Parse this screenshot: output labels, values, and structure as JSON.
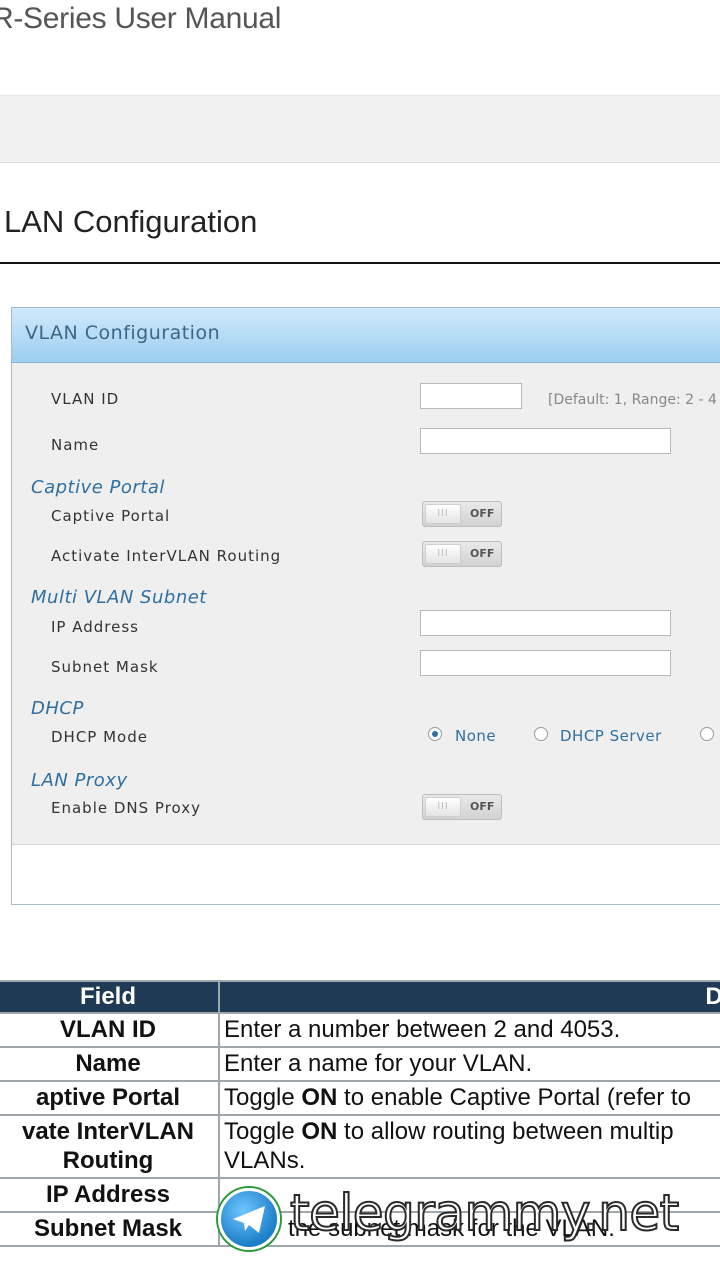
{
  "manual_title": "R-Series User Manual",
  "section_heading": "LAN Configuration",
  "panel": {
    "title": "VLAN Configuration",
    "vlan_id_label": "VLAN ID",
    "vlan_id_hint": "[Default: 1, Range: 2 - 4",
    "name_label": "Name",
    "captive_group": "Captive Portal",
    "captive_label": "Captive Portal",
    "captive_state": "OFF",
    "intervlan_label": "Activate InterVLAN Routing",
    "intervlan_state": "OFF",
    "multi_group": "Multi VLAN Subnet",
    "ip_label": "IP Address",
    "mask_label": "Subnet Mask",
    "dhcp_group": "DHCP",
    "dhcp_mode_label": "DHCP Mode",
    "dhcp_options": [
      "None",
      "DHCP Server"
    ],
    "dhcp_selected": "None",
    "proxy_group": "LAN Proxy",
    "dns_proxy_label": "Enable DNS Proxy",
    "dns_proxy_state": "OFF",
    "toggle_knob_glyph": "III"
  },
  "table": {
    "header_field": "Field",
    "header_desc": "De",
    "rows": [
      {
        "field": "VLAN ID",
        "desc_pre": "Enter a number between 2 and 4053.",
        "desc_bold": "",
        "desc_post": ""
      },
      {
        "field": "Name",
        "desc_pre": "Enter a name for your VLAN.",
        "desc_bold": "",
        "desc_post": ""
      },
      {
        "field": "aptive Portal",
        "desc_pre": "Toggle ",
        "desc_bold": "ON",
        "desc_post": " to enable Captive Portal (refer to"
      },
      {
        "field": "vate InterVLAN Routing",
        "desc_pre": "Toggle ",
        "desc_bold": "ON",
        "desc_post": " to allow routing between multip VLANs."
      },
      {
        "field": "IP Address",
        "desc_pre": "",
        "desc_bold": "",
        "desc_post": ""
      },
      {
        "field": "Subnet Mask",
        "desc_pre": "Enter the subnet mask for the VLAN.",
        "desc_bold": "",
        "desc_post": ""
      }
    ]
  },
  "watermark": "telegrammy.net",
  "colors": {
    "table_header": "#1e3a55",
    "group_label": "#2f6fa1",
    "panel_header": "#9dcff0"
  }
}
